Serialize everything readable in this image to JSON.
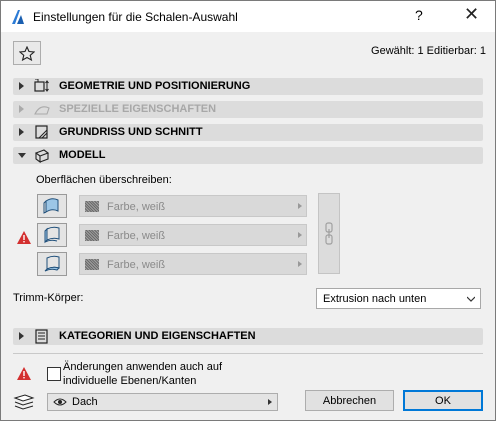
{
  "window": {
    "title": "Einstellungen für die Schalen-Auswahl",
    "help_label": "?",
    "close_label": "✕"
  },
  "status": {
    "text": "Gewählt: 1 Editierbar: 1"
  },
  "sections": [
    {
      "label": "GEOMETRIE UND POSITIONIERUNG",
      "icon": "geometry-icon",
      "expanded": false,
      "enabled": true
    },
    {
      "label": "SPEZIELLE EIGENSCHAFTEN",
      "icon": "special-props-icon",
      "expanded": false,
      "enabled": false
    },
    {
      "label": "GRUNDRISS UND SCHNITT",
      "icon": "floorplan-section-icon",
      "expanded": false,
      "enabled": true
    },
    {
      "label": "MODELL",
      "icon": "model-icon",
      "expanded": true,
      "enabled": true
    },
    {
      "label": "KATEGORIEN UND EIGENSCHAFTEN",
      "icon": "categories-icon",
      "expanded": false,
      "enabled": true
    }
  ],
  "model": {
    "override_label": "Oberflächen überschreiben:",
    "surfaces": [
      {
        "value": "Farbe, weiß",
        "icon": "surface-reference-icon"
      },
      {
        "value": "Farbe, weiß",
        "icon": "surface-opposite-icon"
      },
      {
        "value": "Farbe, weiß",
        "icon": "surface-edge-icon"
      }
    ],
    "trim_label": "Trimm-Körper:",
    "trim_value": "Extrusion nach unten"
  },
  "footer": {
    "apply_label_line1": "Änderungen anwenden auch auf",
    "apply_label_line2": "individuelle Ebenen/Kanten",
    "layer_value": "Dach",
    "cancel_label": "Abbrechen",
    "ok_label": "OK"
  },
  "colors": {
    "accent": "#0078d7",
    "warning": "#d32f2f",
    "section_bg": "#dcdcdc"
  }
}
